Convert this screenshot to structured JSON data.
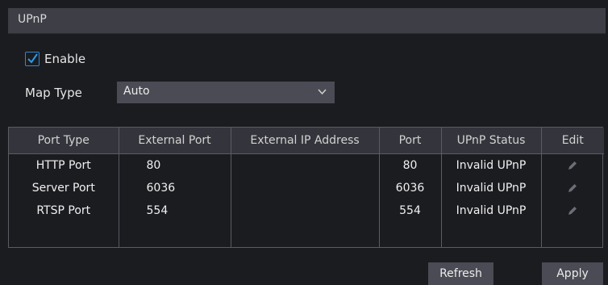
{
  "header": {
    "title": "UPnP"
  },
  "enable": {
    "label": "Enable",
    "checked": true
  },
  "map_type": {
    "label": "Map Type",
    "value": "Auto"
  },
  "table": {
    "columns": [
      "Port Type",
      "External Port",
      "External IP Address",
      "Port",
      "UPnP Status",
      "Edit"
    ],
    "rows": [
      {
        "port_type": "HTTP Port",
        "external_port": "80",
        "external_ip": "",
        "port": "80",
        "status": "Invalid UPnP",
        "edit_icon": "pencil-icon"
      },
      {
        "port_type": "Server Port",
        "external_port": "6036",
        "external_ip": "",
        "port": "6036",
        "status": "Invalid UPnP",
        "edit_icon": "pencil-icon"
      },
      {
        "port_type": "RTSP Port",
        "external_port": "554",
        "external_ip": "",
        "port": "554",
        "status": "Invalid UPnP",
        "edit_icon": "pencil-icon"
      }
    ]
  },
  "buttons": {
    "refresh": "Refresh",
    "apply": "Apply"
  },
  "colors": {
    "background": "#1b1c20",
    "accent": "#2d87d6",
    "panel": "#3d3e46",
    "control": "#4a4b54"
  }
}
